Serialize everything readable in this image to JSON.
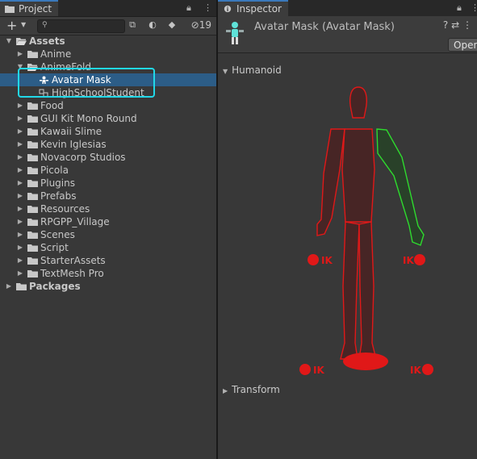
{
  "project": {
    "tab_label": "Project",
    "hidden_count": "19",
    "search": {
      "placeholder": ""
    },
    "tree": [
      {
        "label": "Assets",
        "depth": 0,
        "expanded": true,
        "bold": true,
        "icon": "folder-open-icon"
      },
      {
        "label": "Anime",
        "depth": 1,
        "expanded": false,
        "icon": "folder-icon"
      },
      {
        "label": "AnimeFold",
        "depth": 1,
        "expanded": true,
        "icon": "folder-open-icon"
      },
      {
        "label": "Avatar Mask",
        "depth": 2,
        "selected": true,
        "icon": "avatar-mask-icon"
      },
      {
        "label": "HighSchoolStudent",
        "depth": 2,
        "icon": "prefab-model-icon"
      },
      {
        "label": "Food",
        "depth": 1,
        "expanded": false,
        "icon": "folder-icon"
      },
      {
        "label": "GUI Kit Mono Round",
        "depth": 1,
        "expanded": false,
        "icon": "folder-icon"
      },
      {
        "label": "Kawaii Slime",
        "depth": 1,
        "expanded": false,
        "icon": "folder-icon"
      },
      {
        "label": "Kevin Iglesias",
        "depth": 1,
        "expanded": false,
        "icon": "folder-icon"
      },
      {
        "label": "Novacorp Studios",
        "depth": 1,
        "expanded": false,
        "icon": "folder-icon"
      },
      {
        "label": "Picola",
        "depth": 1,
        "expanded": false,
        "icon": "folder-icon"
      },
      {
        "label": "Plugins",
        "depth": 1,
        "expanded": false,
        "icon": "folder-icon"
      },
      {
        "label": "Prefabs",
        "depth": 1,
        "expanded": false,
        "icon": "folder-icon"
      },
      {
        "label": "Resources",
        "depth": 1,
        "expanded": false,
        "icon": "folder-icon"
      },
      {
        "label": "RPGPP_Village",
        "depth": 1,
        "expanded": false,
        "icon": "folder-icon"
      },
      {
        "label": "Scenes",
        "depth": 1,
        "expanded": false,
        "icon": "folder-icon"
      },
      {
        "label": "Script",
        "depth": 1,
        "expanded": false,
        "icon": "folder-icon"
      },
      {
        "label": "StarterAssets",
        "depth": 1,
        "expanded": false,
        "icon": "folder-icon"
      },
      {
        "label": "TextMesh Pro",
        "depth": 1,
        "expanded": false,
        "icon": "folder-icon"
      },
      {
        "label": "Packages",
        "depth": 0,
        "expanded": false,
        "bold": true,
        "icon": "folder-icon"
      }
    ]
  },
  "inspector": {
    "tab_label": "Inspector",
    "title": "Avatar Mask (Avatar Mask)",
    "help_icon": "?",
    "open_button": "Open",
    "humanoid_label": "Humanoid",
    "transform_label": "Transform",
    "ik_label": "IK",
    "colors": {
      "inactive": "#e01818",
      "active": "#2edb2e",
      "selection": "#2c5d87",
      "highlight": "#21d8e8"
    }
  }
}
